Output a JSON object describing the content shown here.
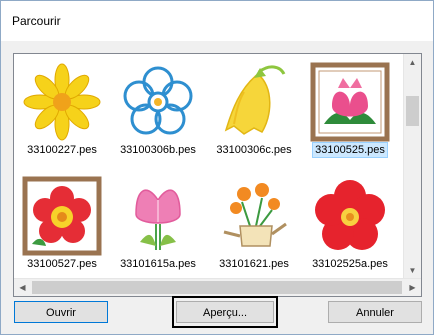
{
  "window": {
    "title": "Parcourir"
  },
  "files": [
    {
      "name": "33100227.pes",
      "selected": false
    },
    {
      "name": "33100306b.pes",
      "selected": false
    },
    {
      "name": "33100306c.pes",
      "selected": false
    },
    {
      "name": "33100525.pes",
      "selected": true
    },
    {
      "name": "33100527.pes",
      "selected": false
    },
    {
      "name": "33101615a.pes",
      "selected": false
    },
    {
      "name": "33101621.pes",
      "selected": false
    },
    {
      "name": "33102525a.pes",
      "selected": false
    }
  ],
  "buttons": {
    "open": "Ouvrir",
    "preview": "Aperçu...",
    "cancel": "Annuler"
  },
  "icons": [
    "chevron-up-icon",
    "chevron-down-icon",
    "chevron-left-icon",
    "chevron-right-icon"
  ]
}
